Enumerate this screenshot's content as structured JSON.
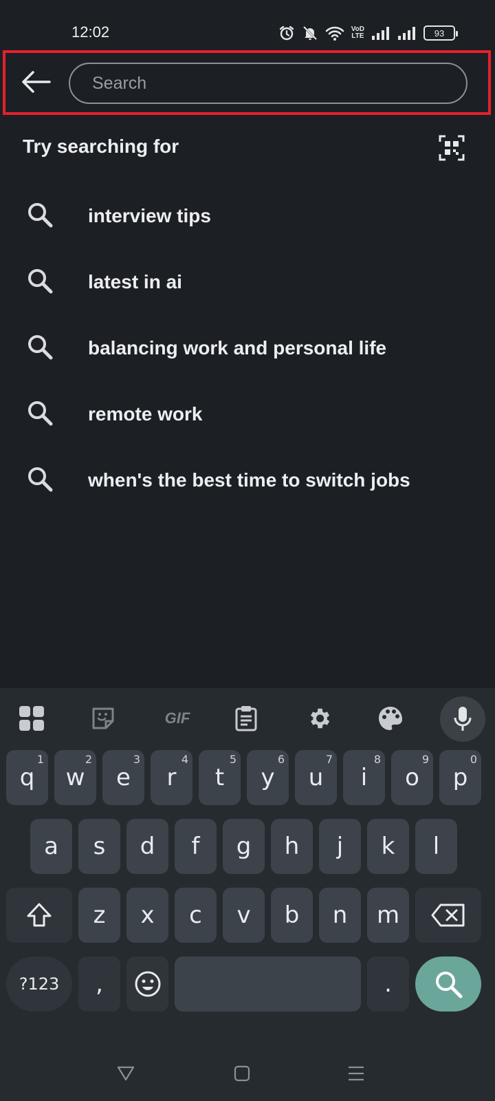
{
  "status_bar": {
    "time": "12:02",
    "network_label_top": "VoD",
    "network_label_bottom": "LTE",
    "battery": "93"
  },
  "search": {
    "placeholder": "Search"
  },
  "suggestions": {
    "title": "Try searching for",
    "items": [
      {
        "label": "interview tips"
      },
      {
        "label": "latest in ai"
      },
      {
        "label": "balancing work and personal life"
      },
      {
        "label": "remote work"
      },
      {
        "label": "when's the best time to switch jobs"
      }
    ]
  },
  "keyboard": {
    "toolbar": {
      "gif": "GIF"
    },
    "row1": [
      {
        "key": "q",
        "hint": "1"
      },
      {
        "key": "w",
        "hint": "2"
      },
      {
        "key": "e",
        "hint": "3"
      },
      {
        "key": "r",
        "hint": "4"
      },
      {
        "key": "t",
        "hint": "5"
      },
      {
        "key": "y",
        "hint": "6"
      },
      {
        "key": "u",
        "hint": "7"
      },
      {
        "key": "i",
        "hint": "8"
      },
      {
        "key": "o",
        "hint": "9"
      },
      {
        "key": "p",
        "hint": "0"
      }
    ],
    "row2": [
      "a",
      "s",
      "d",
      "f",
      "g",
      "h",
      "j",
      "k",
      "l"
    ],
    "row3": [
      "z",
      "x",
      "c",
      "v",
      "b",
      "n",
      "m"
    ],
    "symbols_label": "?123",
    "comma": ",",
    "period": "."
  },
  "colors": {
    "accent_search_key": "#6ba69b",
    "highlight_border": "#e5202b",
    "background": "#1c1f24"
  }
}
